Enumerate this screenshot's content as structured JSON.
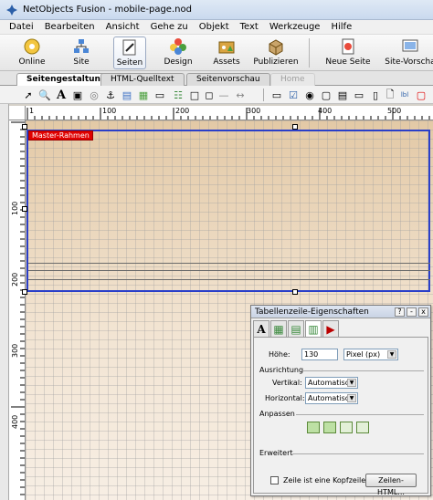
{
  "window": {
    "title": "NetObjects Fusion - mobile-page.nod"
  },
  "menu": [
    "Datei",
    "Bearbeiten",
    "Ansicht",
    "Gehe zu",
    "Objekt",
    "Text",
    "Werkzeuge",
    "Hilfe"
  ],
  "toolbar": {
    "online": "Online",
    "site": "Site",
    "seiten": "Seiten",
    "design": "Design",
    "assets": "Assets",
    "publizieren": "Publizieren",
    "neue_seite": "Neue Seite",
    "site_vorschau": "Site-Vorscha"
  },
  "tabs": {
    "seitengestaltung": "Seitengestaltung",
    "html_quelltext": "HTML-Quelltext",
    "seitenvorschau": "Seitenvorschau",
    "home": "Home"
  },
  "ruler": {
    "top": [
      "1",
      "100",
      "200",
      "300",
      "400",
      "500"
    ],
    "left": [
      "100",
      "200",
      "300",
      "400"
    ]
  },
  "canvas": {
    "master_label": "Master-Rahmen"
  },
  "panel": {
    "title": "Tabellenzeile-Eigenschaften",
    "help": "?",
    "minimize": "-",
    "close": "x",
    "hoehe_label": "Höhe:",
    "hoehe_value": "130",
    "unit_value": "Pixel (px)",
    "ausrichtung": "Ausrichtung",
    "vertikal_label": "Vertikal:",
    "vertikal_value": "Automatisch",
    "horizontal_label": "Horizontal:",
    "horizontal_value": "Automatisch",
    "anpassen": "Anpassen",
    "erweitert": "Erweitert",
    "kopfzeile_label": "Zeile ist eine Kopfzeile",
    "zeilen_html_button": "Zeilen-HTML..."
  },
  "colors": {
    "frame_border": "#2a3fc9",
    "master_label_bg": "#e00000",
    "canvas_bg": "#e3c9a6"
  }
}
